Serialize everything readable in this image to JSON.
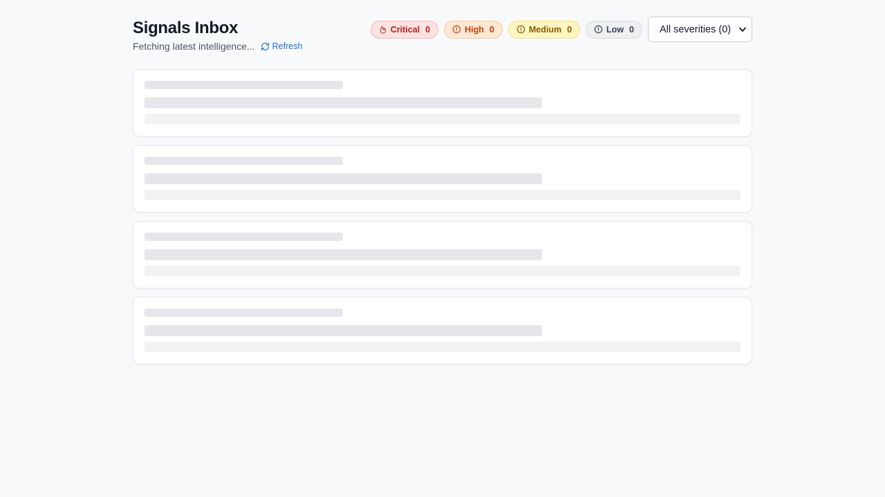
{
  "header": {
    "title": "Signals Inbox",
    "status_text": "Fetching latest intelligence...",
    "refresh_label": "Refresh"
  },
  "severity_badges": [
    {
      "label": "Critical",
      "count": "0",
      "icon": "flame-icon",
      "color": "#b91c1c"
    },
    {
      "label": "High",
      "count": "0",
      "icon": "alert-circle-icon",
      "color": "#c2410c"
    },
    {
      "label": "Medium",
      "count": "0",
      "icon": "alert-circle-icon",
      "color": "#8a5a07"
    },
    {
      "label": "Low",
      "count": "0",
      "icon": "alert-circle-icon",
      "color": "#374151"
    }
  ],
  "severity_filter": {
    "selected": "All severities (0)"
  },
  "accent_color": "#1d6fd6"
}
